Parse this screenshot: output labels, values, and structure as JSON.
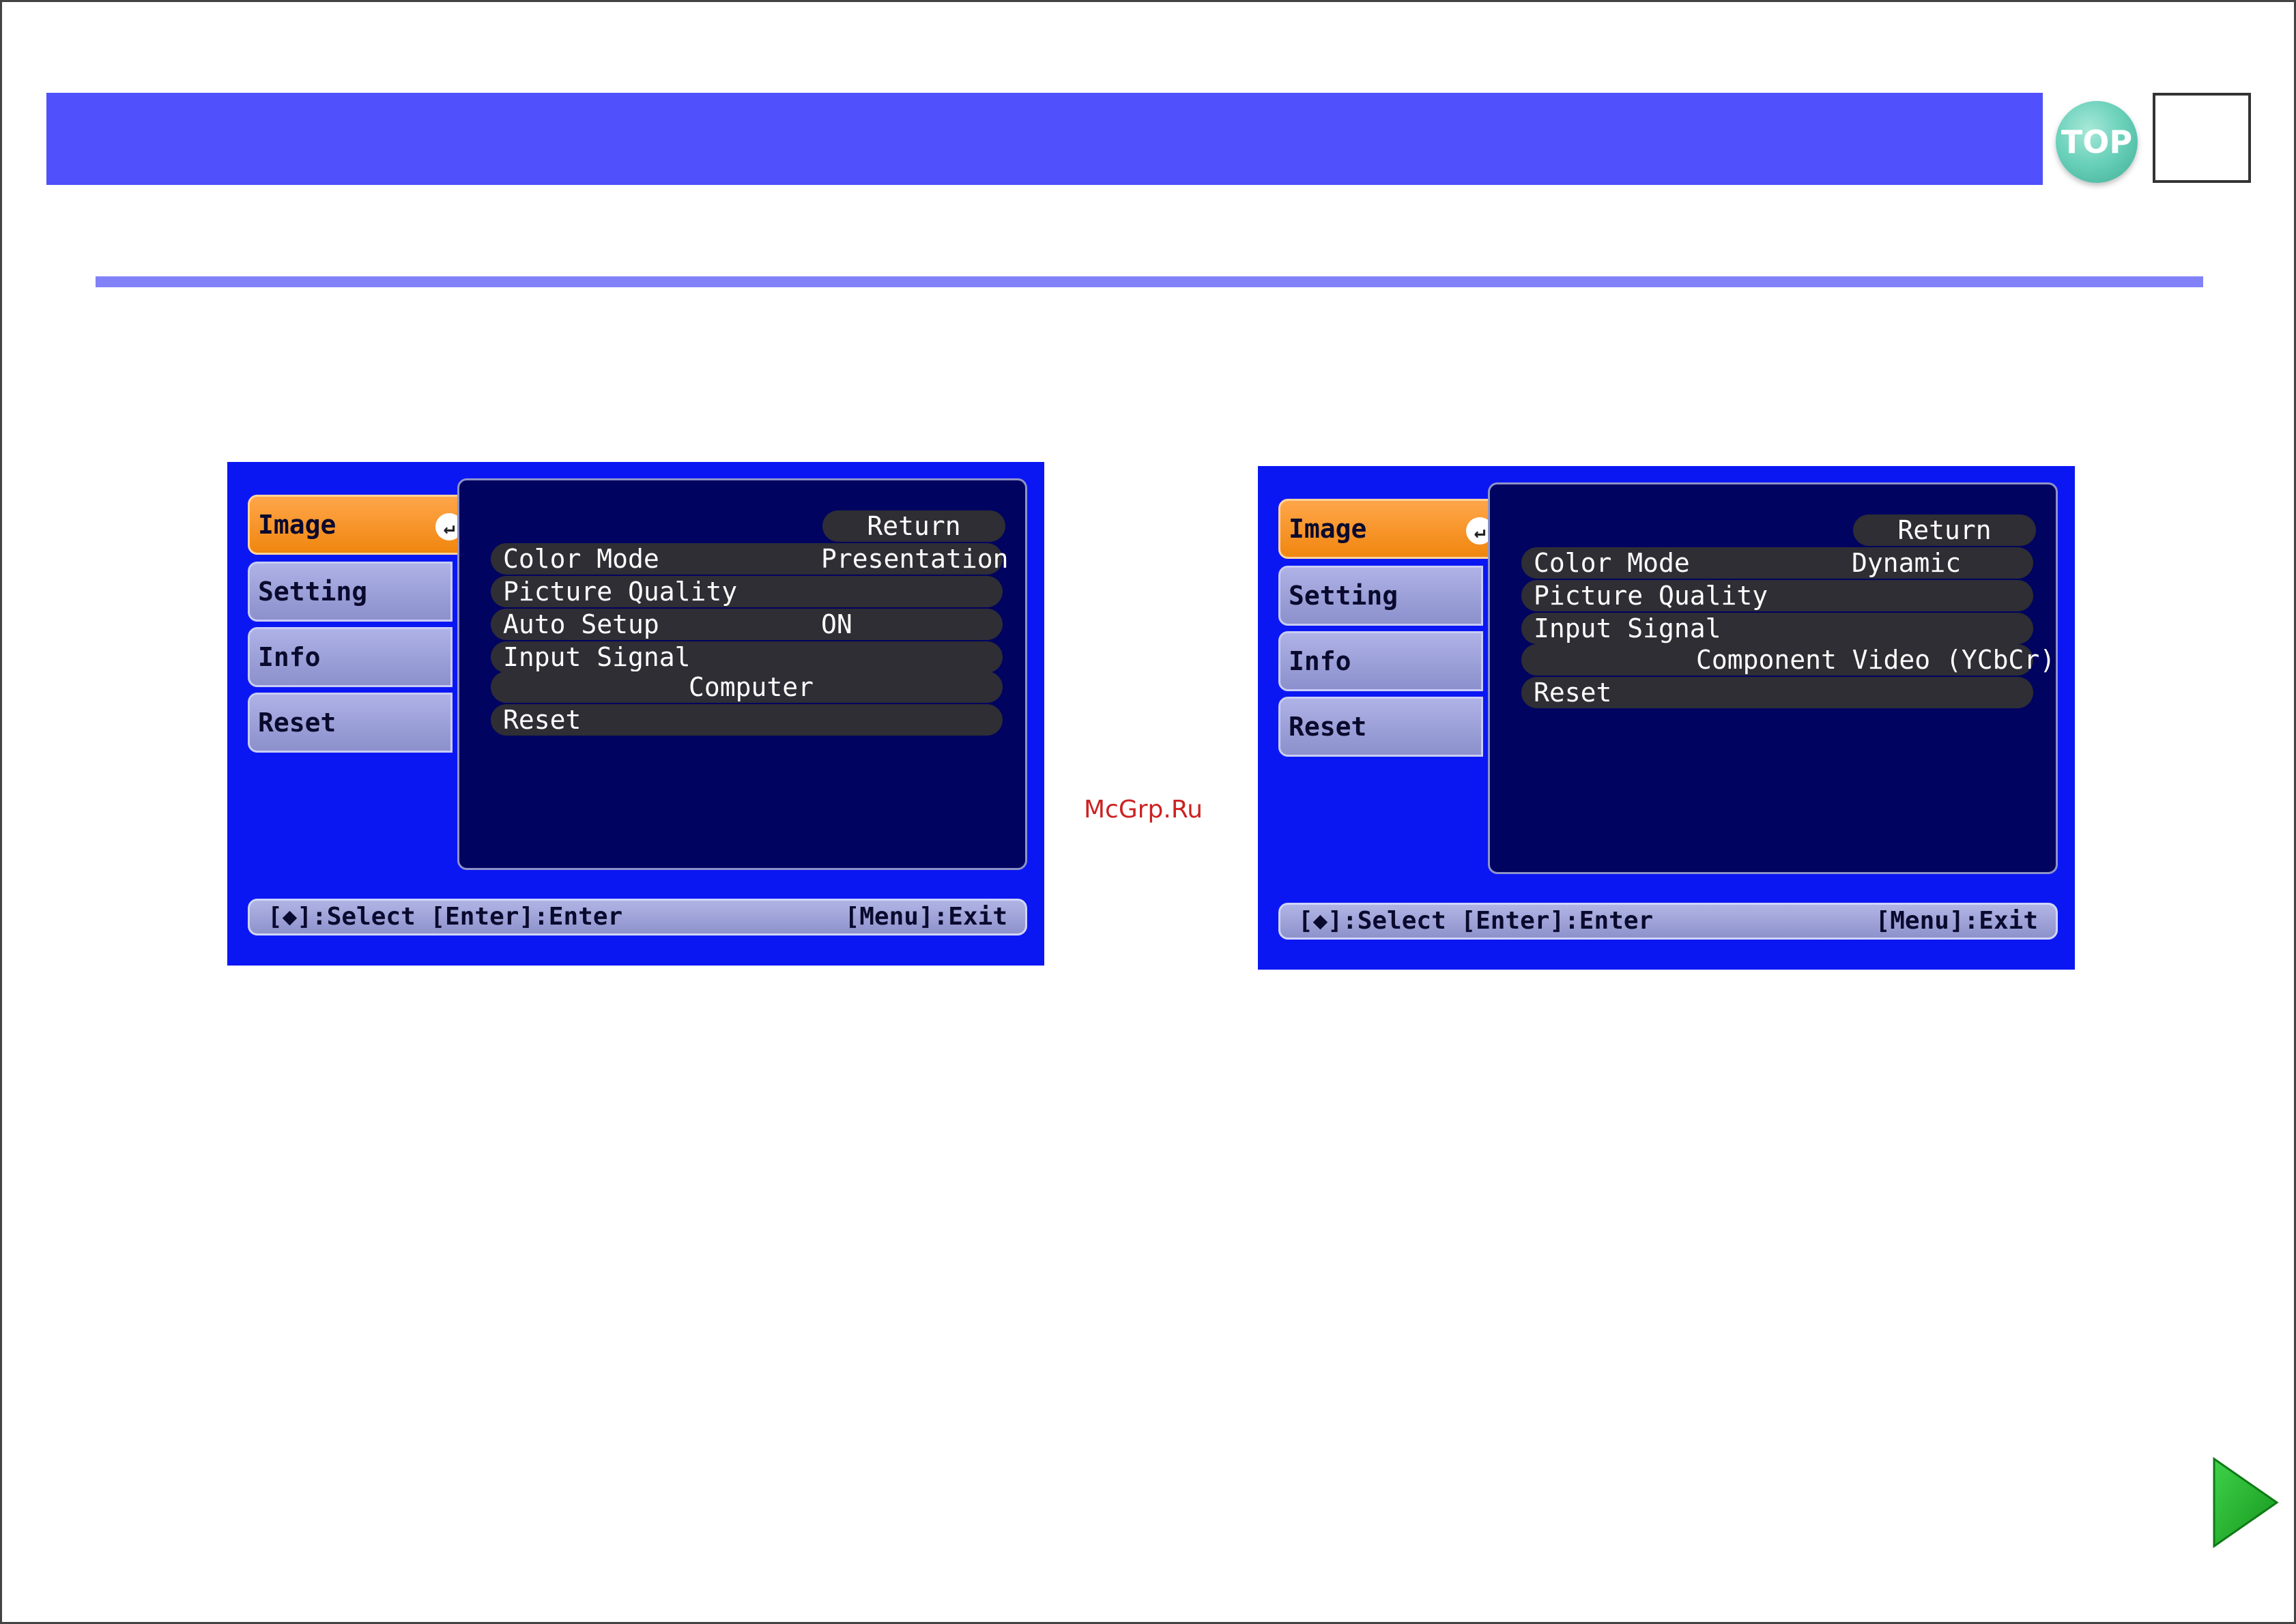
{
  "header": {
    "top_label": "TOP"
  },
  "watermark": "McGrp.Ru",
  "osd_left": {
    "tabs": [
      "Image",
      "Setting",
      "Info",
      "Reset"
    ],
    "enter_glyph": "↵",
    "return_label": "Return",
    "rows": [
      {
        "label": "Color Mode",
        "value": "Presentation"
      },
      {
        "label": "Picture Quality",
        "value": ""
      },
      {
        "label": "Auto Setup",
        "value": "ON"
      },
      {
        "label": "Input Signal",
        "value": ""
      }
    ],
    "input_signal_value": "Computer",
    "reset_label": "Reset",
    "status_left": "[◆]:Select [Enter]:Enter",
    "status_right": "[Menu]:Exit"
  },
  "osd_right": {
    "tabs": [
      "Image",
      "Setting",
      "Info",
      "Reset"
    ],
    "enter_glyph": "↵",
    "return_label": "Return",
    "rows": [
      {
        "label": "Color Mode",
        "value": "Dynamic"
      },
      {
        "label": "Picture Quality",
        "value": ""
      },
      {
        "label": "Input Signal",
        "value": ""
      }
    ],
    "input_signal_value": "Component Video (YCbCr)",
    "reset_label": "Reset",
    "status_left": "[◆]:Select [Enter]:Enter",
    "status_right": "[Menu]:Exit"
  },
  "colors": {
    "header_bar": "#5050fc",
    "osd_background": "#0b17f3",
    "active_tab": "#f0860f",
    "next_arrow": "#22b02a"
  },
  "icons": {
    "top": "top-circle-icon",
    "next": "next-page-arrow-icon",
    "enter": "enter-icon"
  }
}
